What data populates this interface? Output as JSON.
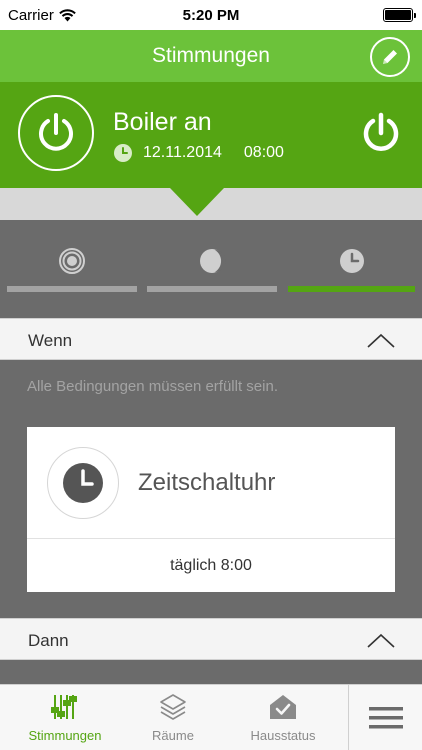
{
  "status_bar": {
    "carrier": "Carrier",
    "time": "5:20 PM"
  },
  "nav": {
    "title": "Stimmungen"
  },
  "hero": {
    "name": "Boiler an",
    "date": "12.11.2014",
    "time": "08:00"
  },
  "mode_tabs": [
    {
      "icon": "target-icon",
      "active": false
    },
    {
      "icon": "moon-icon",
      "active": false
    },
    {
      "icon": "clock-icon",
      "active": true
    }
  ],
  "sections": {
    "if_label": "Wenn",
    "then_label": "Dann"
  },
  "hint": "Alle Bedingungen müssen erfüllt sein.",
  "condition_card": {
    "title": "Zeitschaltuhr",
    "detail": "täglich 8:00"
  },
  "tabbar": {
    "items": [
      {
        "label": "Stimmungen",
        "icon": "sliders-icon",
        "active": true
      },
      {
        "label": "Räume",
        "icon": "layers-icon",
        "active": false
      },
      {
        "label": "Hausstatus",
        "icon": "house-check-icon",
        "active": false
      }
    ]
  },
  "colors": {
    "accent": "#6cc23a",
    "accent_dark": "#55a513",
    "background": "#6b6b6b"
  }
}
